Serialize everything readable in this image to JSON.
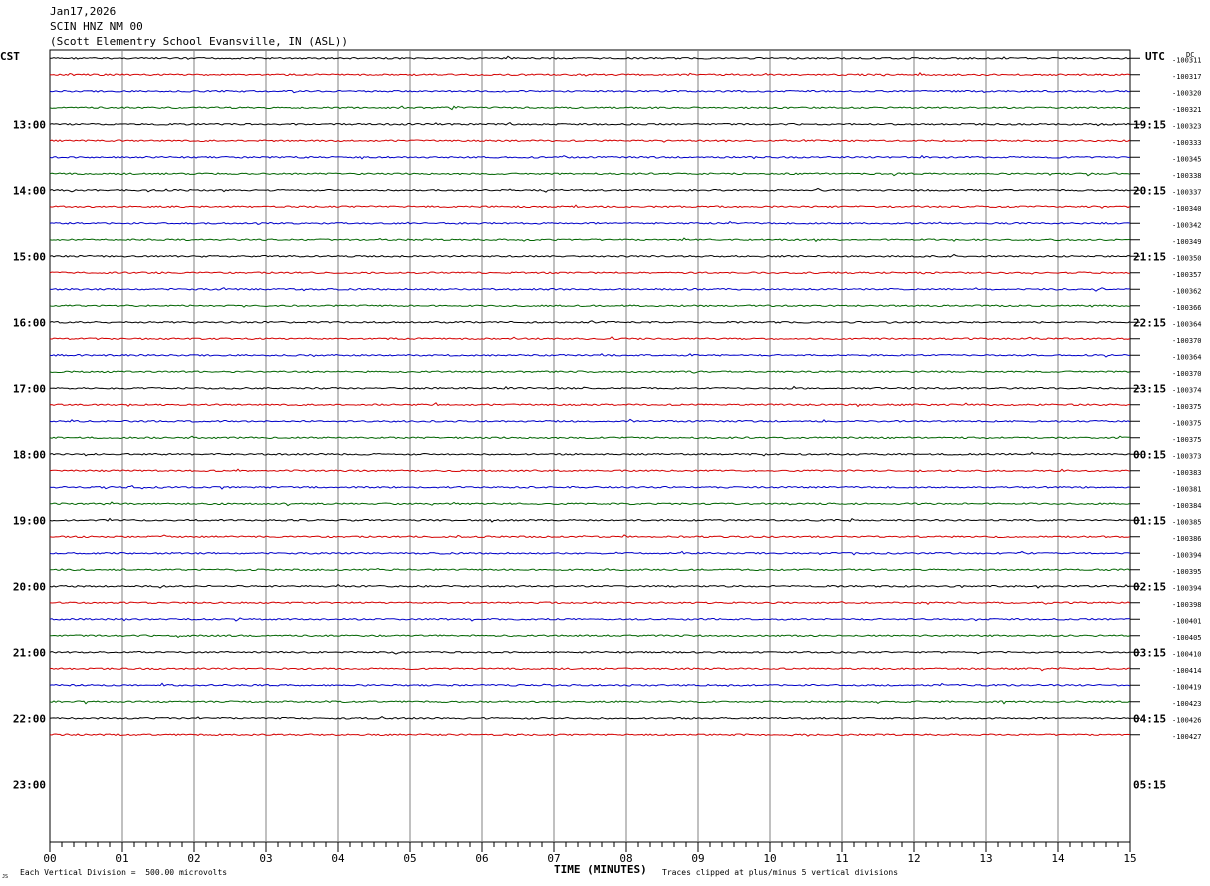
{
  "header": {
    "date": "Jan17,2026",
    "station": "SCIN HNZ NM 00",
    "location": "(Scott Elementry School Evansville, IN (ASL))"
  },
  "left_tz": "CST",
  "right_tz": "UTC",
  "dc_label": "DC",
  "footer": {
    "scale_note": "Each Vertical Division =  500.00 microvolts",
    "x_axis_title": "TIME (MINUTES)",
    "clip_note": "Traces clipped at plus/minus 5 vertical divisions",
    "corner_mark": "JS"
  },
  "chart_data": {
    "type": "line",
    "title": "SCIN HNZ NM 00",
    "xlabel": "TIME (MINUTES)",
    "ylabel": "",
    "xlim": [
      0,
      15
    ],
    "x_ticks": [
      "00",
      "01",
      "02",
      "03",
      "04",
      "05",
      "06",
      "07",
      "08",
      "09",
      "10",
      "11",
      "12",
      "13",
      "14",
      "15"
    ],
    "rows_per_hour": 4,
    "hours_total": 12,
    "hour_labels_left": [
      "13:00",
      "14:00",
      "15:00",
      "16:00",
      "17:00",
      "18:00",
      "19:00",
      "20:00",
      "21:00",
      "22:00",
      "23:00"
    ],
    "hour_labels_right": [
      "19:15",
      "20:15",
      "21:15",
      "22:15",
      "23:15",
      "00:15",
      "01:15",
      "02:15",
      "03:15",
      "04:15",
      "05:15"
    ],
    "trace_colors": [
      "#000000",
      "#d40000",
      "#0000c8",
      "#006400"
    ],
    "traces_recorded": 42,
    "dc_offsets": [
      "-100311",
      "-100317",
      "-100320",
      "-100321",
      "-100323",
      "-100333",
      "-100345",
      "-100338",
      "-100337",
      "-100340",
      "-100342",
      "-100349",
      "-100350",
      "-100357",
      "-100362",
      "-100366",
      "-100364",
      "-100370",
      "-100364",
      "-100370",
      "-100374",
      "-100375",
      "-100375",
      "-100375",
      "-100373",
      "-100383",
      "-100381",
      "-100384",
      "-100385",
      "-100386",
      "-100394",
      "-100395",
      "-100394",
      "-100398",
      "-100401",
      "-100405",
      "-100410",
      "-100414",
      "-100419",
      "-100423",
      "-100426",
      "-100427"
    ]
  }
}
